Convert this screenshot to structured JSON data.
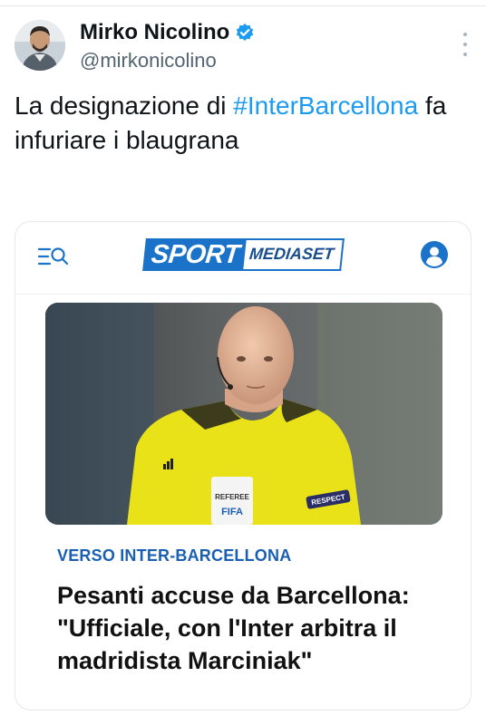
{
  "author": {
    "display_name": "Mirko Nicolino",
    "handle": "@mirkonicolino",
    "verified": true,
    "accent": "#1d9bf0"
  },
  "tweet": {
    "text_before": "La designazione di ",
    "hashtag": "#InterBarcellona",
    "text_after": " fa infuriare i blaugrana"
  },
  "card": {
    "nav_icons": [
      "menu-search-icon",
      "user-account-icon"
    ],
    "logo": {
      "sport": "SPORT",
      "mediaset": "MEDIASET",
      "brand_color": "#1a73c8"
    },
    "hero_image": {
      "subject": "referee-photo",
      "badge_referee": "REFEREE",
      "badge_fifa": "FIFA",
      "sleeve_patch": "RESPECT"
    },
    "kicker": "VERSO INTER-BARCELLONA",
    "headline": "Pesanti accuse da Barcellona: \"Ufficiale, con l'Inter arbitra il madridista Marciniak\""
  }
}
